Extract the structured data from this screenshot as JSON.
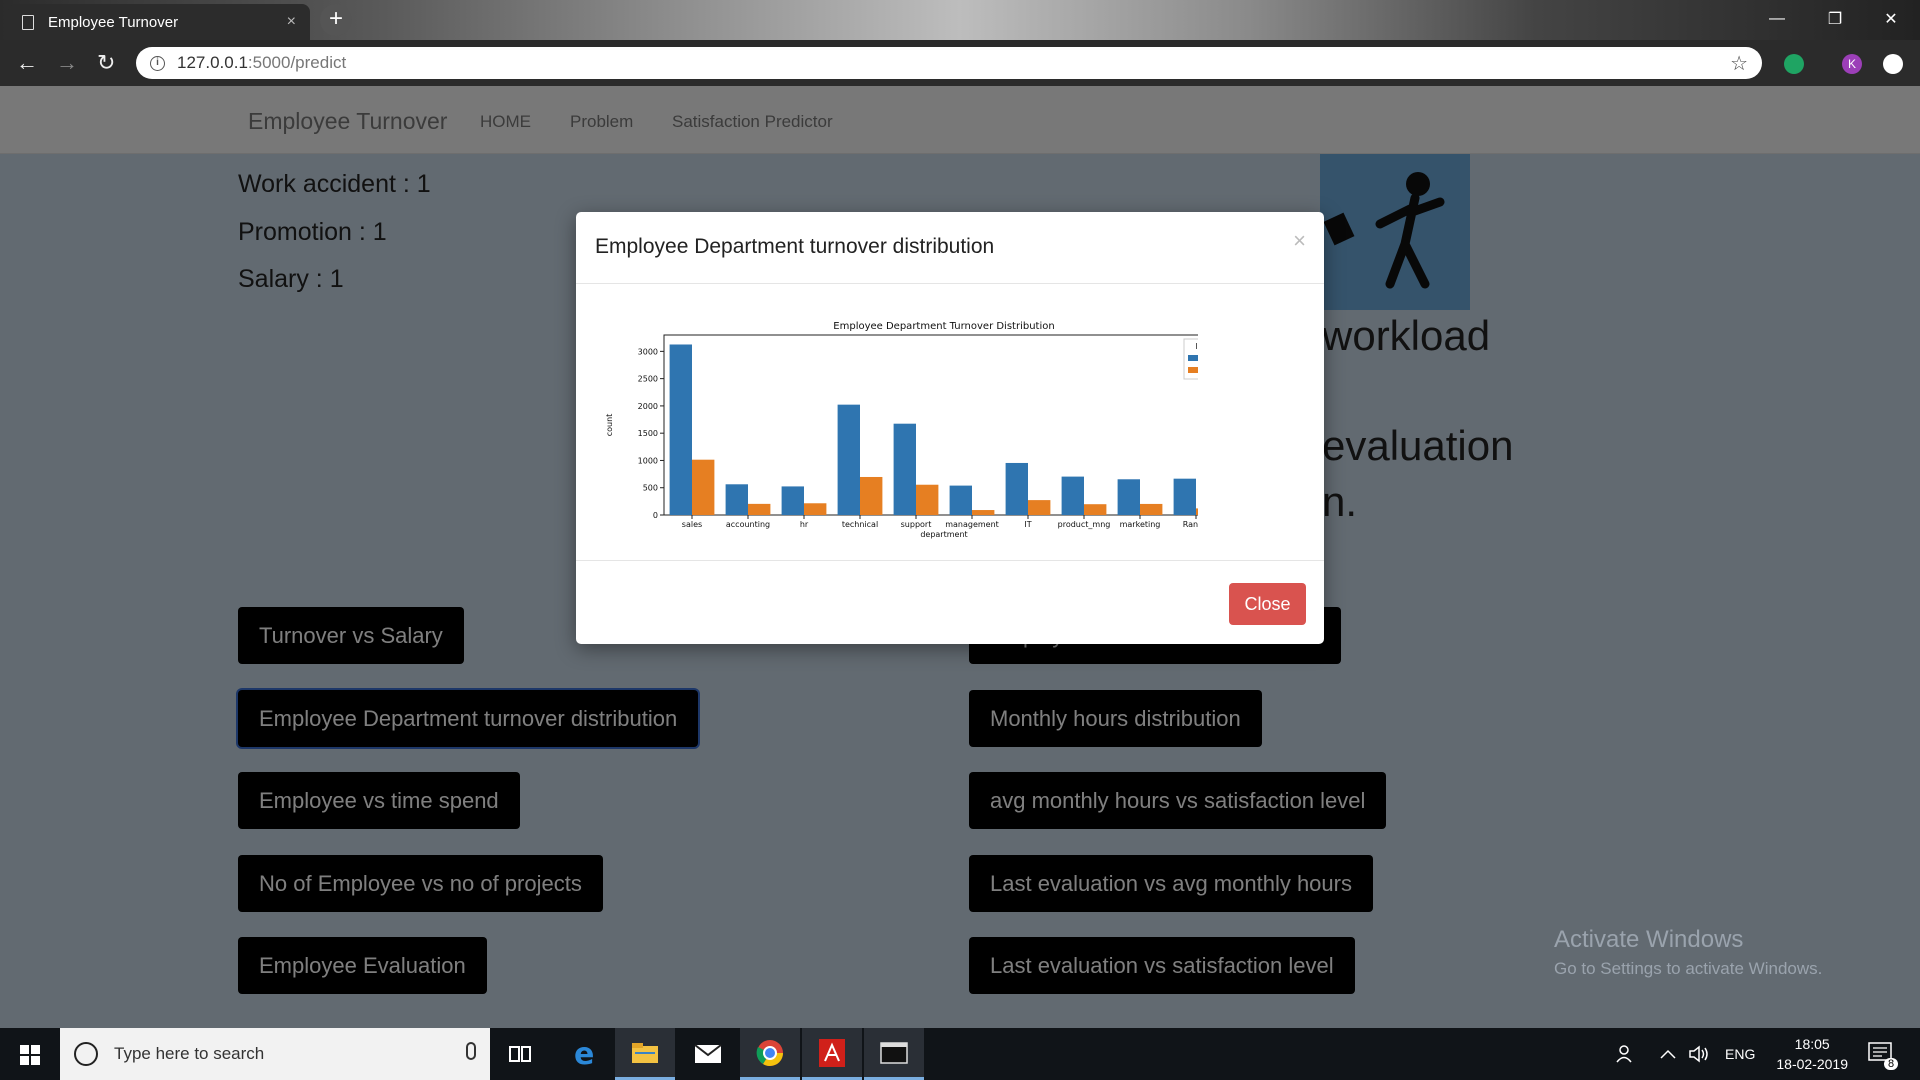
{
  "browser": {
    "tab_title": "Employee Turnover",
    "tab_close": "×",
    "new_tab": "+",
    "url_host": "127.0.0.1",
    "url_path": ":5000/predict",
    "back": "←",
    "forward": "→",
    "reload": "↻",
    "star": "☆",
    "profile_initial": "K",
    "win_minimize": "—",
    "win_restore": "❐",
    "win_close": "✕"
  },
  "navbar": {
    "brand": "Employee Turnover",
    "links": [
      "HOME",
      "Problem",
      "Satisfaction Predictor"
    ]
  },
  "result": {
    "lines": [
      "Work accident : 1",
      "Promotion : 1",
      "Salary : 1"
    ],
    "fragments": [
      "workload",
      "evaluation",
      "n."
    ]
  },
  "buttons": {
    "left": [
      "Turnover vs Salary",
      "Employee Department turnover distribution",
      "Employee vs time spend",
      "No of Employee vs no of projects",
      "Employee Evaluation"
    ],
    "right": [
      "Employee satisfaction Distribution",
      "Monthly hours distribution",
      "avg monthly hours vs satisfaction level",
      "Last evaluation vs avg monthly hours",
      "Last evaluation vs satisfaction level"
    ]
  },
  "modal": {
    "title": "Employee Department turnover distribution",
    "close_x": "×",
    "close_label": "Close"
  },
  "watermark": {
    "title": "Activate Windows",
    "subtitle": "Go to Settings to activate Windows."
  },
  "taskbar": {
    "search_placeholder": "Type here to search",
    "lang": "ENG",
    "time": "18:05",
    "date": "18-02-2019",
    "notification_count": "8"
  },
  "colors": {
    "series_0": "#2f75b0",
    "series_1": "#e67f22",
    "close_button": "#d9534f"
  },
  "chart_data": {
    "type": "bar",
    "title": "Employee Department Turnover Distribution",
    "xlabel": "department",
    "ylabel": "count",
    "categories": [
      "sales",
      "accounting",
      "hr",
      "technical",
      "support",
      "management",
      "IT",
      "product_mng",
      "marketing",
      "RandD"
    ],
    "series": [
      {
        "name": "0",
        "values": [
          3126,
          563,
          524,
          2023,
          1674,
          539,
          954,
          704,
          655,
          666
        ]
      },
      {
        "name": "1",
        "values": [
          1014,
          204,
          215,
          697,
          555,
          91,
          273,
          198,
          203,
          121
        ]
      }
    ],
    "ylim": [
      0,
      3300
    ],
    "yticks": [
      0,
      500,
      1000,
      1500,
      2000,
      2500,
      3000
    ],
    "legend_title": "left",
    "legend_position": "top-right",
    "grid": false
  }
}
